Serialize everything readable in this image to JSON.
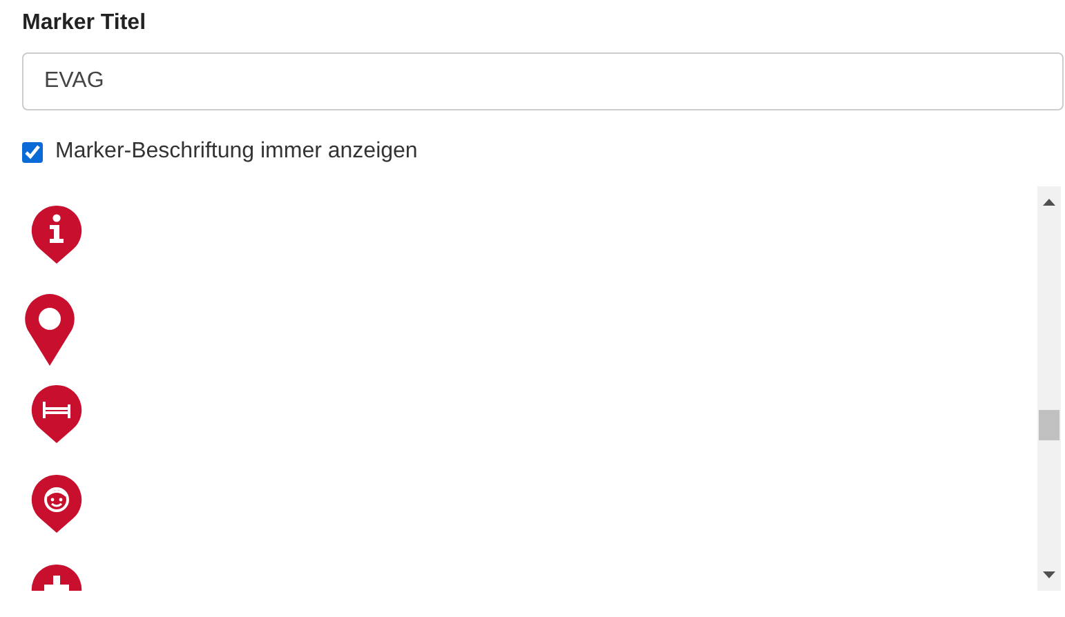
{
  "field_label": "Marker Titel",
  "title_input": {
    "value": "EVAG"
  },
  "label_checkbox": {
    "label": "Marker-Beschriftung immer anzeigen",
    "checked": true
  },
  "markers": [
    {
      "kind": "info"
    },
    {
      "kind": "pin"
    },
    {
      "kind": "bed"
    },
    {
      "kind": "face"
    },
    {
      "kind": "plus"
    }
  ]
}
